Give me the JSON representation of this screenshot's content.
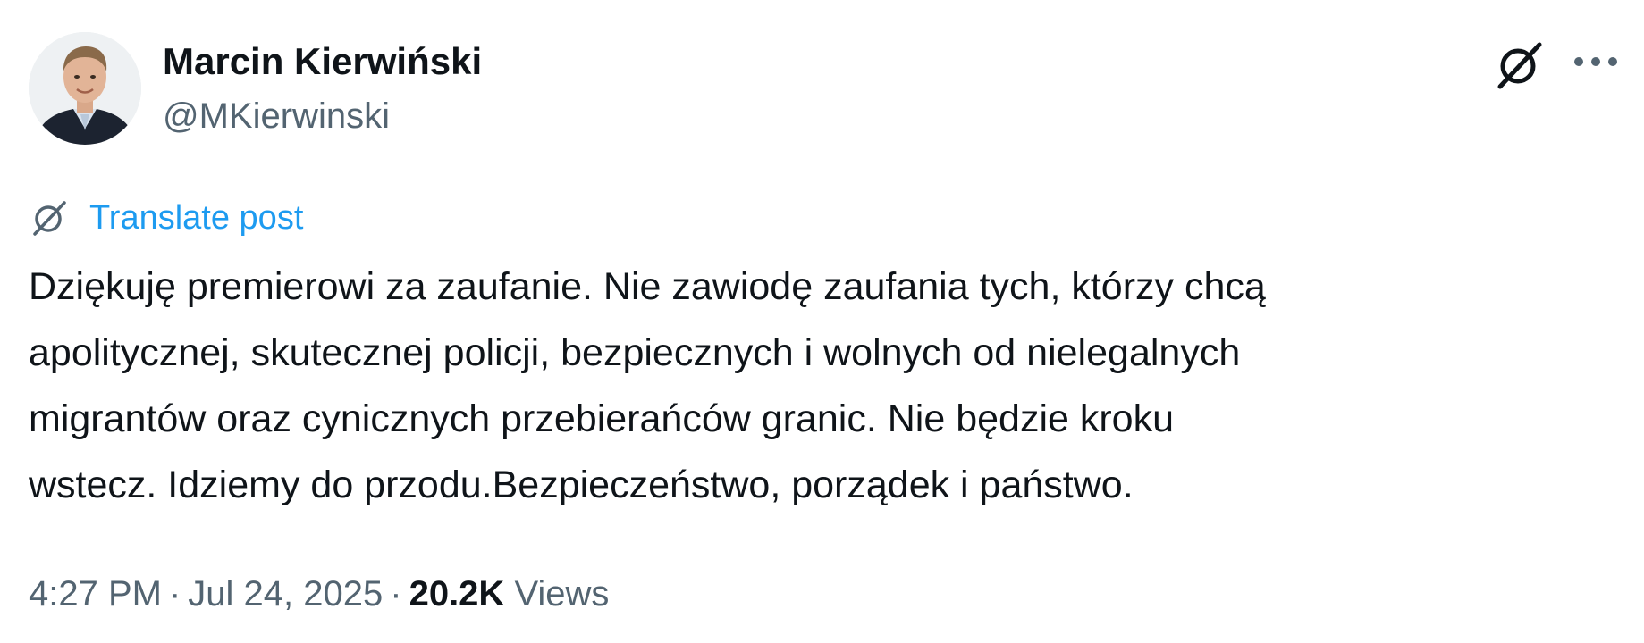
{
  "author": {
    "display_name": "Marcin Kierwiński",
    "handle": "@MKierwinski"
  },
  "actions": {
    "grok_icon": "grok-slash-icon",
    "more_icon": "more-horizontal-icon"
  },
  "translate": {
    "label": "Translate post",
    "icon": "grok-slash-icon"
  },
  "tweet": {
    "lines": [
      "Dziękuję premierowi za zaufanie. Nie zawiodę zaufania tych, którzy chcą",
      "apolitycznej, skutecznej policji, bezpiecznych i wolnych od nielegalnych",
      "migrantów oraz cynicznych przebierańców granic. Nie będzie kroku",
      "wstecz. Idziemy do przodu.Bezpieczeństwo, porządek i państwo."
    ]
  },
  "meta": {
    "time": "4:27 PM",
    "separator": "·",
    "date": "Jul 24, 2025",
    "views_count": "20.2K",
    "views_label": "Views"
  },
  "colors": {
    "link": "#1d9bf0",
    "secondary_text": "#536471",
    "primary_text": "#0f1419"
  }
}
